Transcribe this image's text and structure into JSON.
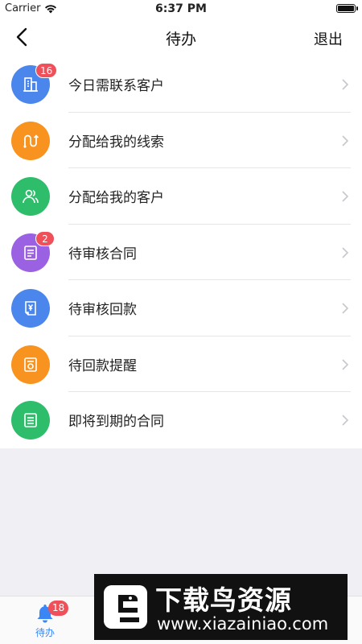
{
  "status_bar": {
    "carrier": "Carrier",
    "time": "6:37 PM"
  },
  "nav": {
    "title": "待办",
    "right_action": "退出"
  },
  "items": [
    {
      "label": "今日需联系客户",
      "icon": "building-icon",
      "color": "#4a86ec",
      "badge": "16"
    },
    {
      "label": "分配给我的线索",
      "icon": "route-icon",
      "color": "#f7931e",
      "badge": ""
    },
    {
      "label": "分配给我的客户",
      "icon": "users-icon",
      "color": "#2ebd6b",
      "badge": ""
    },
    {
      "label": "待审核合同",
      "icon": "document-icon",
      "color": "#9a62e3",
      "badge": "2"
    },
    {
      "label": "待审核回款",
      "icon": "yen-receipt-icon",
      "color": "#4a86ec",
      "badge": ""
    },
    {
      "label": "待回款提醒",
      "icon": "invoice-icon",
      "color": "#f7931e",
      "badge": ""
    },
    {
      "label": "即将到期的合同",
      "icon": "contract-icon",
      "color": "#2ebd6b",
      "badge": ""
    }
  ],
  "tab_bar": {
    "label": "待办",
    "badge": "18",
    "accent": "#3a86f5"
  },
  "watermark": {
    "title": "下载鸟资源",
    "url": "www.xiazainiao.com"
  }
}
